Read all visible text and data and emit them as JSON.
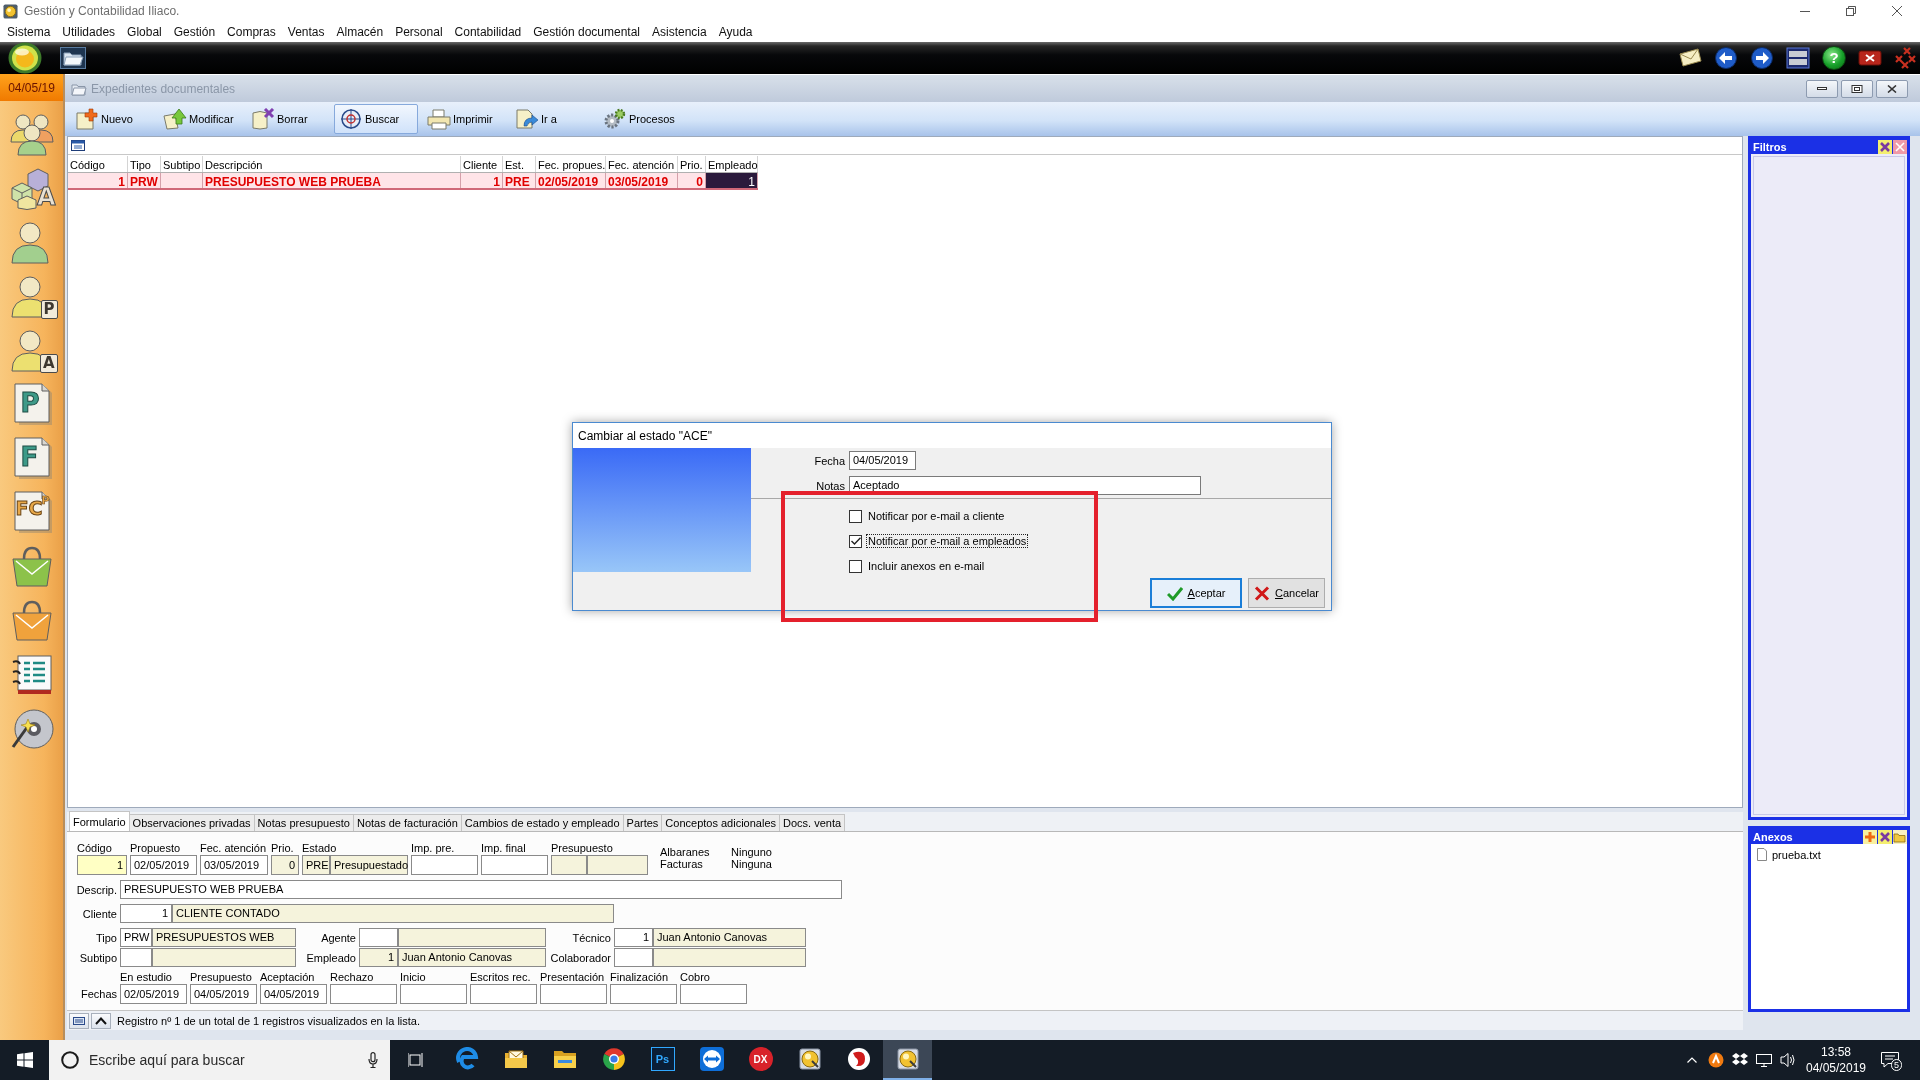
{
  "window": {
    "title": "Gestión y Contabilidad Iliaco."
  },
  "menu": [
    "Sistema",
    "Utilidades",
    "Global",
    "Gestión",
    "Compras",
    "Ventas",
    "Almacén",
    "Personal",
    "Contabilidad",
    "Gestión documental",
    "Asistencia",
    "Ayuda"
  ],
  "main_toolbar": {
    "help_button": "?"
  },
  "sidebar": {
    "date": "04/05/19",
    "items": [
      {
        "kind": "people"
      },
      {
        "kind": "boxes",
        "letter": "A"
      },
      {
        "kind": "person"
      },
      {
        "kind": "person",
        "letter": "P"
      },
      {
        "kind": "person",
        "letter": "A"
      },
      {
        "kind": "document",
        "letter": "P"
      },
      {
        "kind": "document",
        "letter": "F"
      },
      {
        "kind": "document",
        "letter": "FC",
        "corner": "P"
      },
      {
        "kind": "bag",
        "color": "#8cc24a"
      },
      {
        "kind": "bag",
        "color": "#f0a23c"
      },
      {
        "kind": "notebook"
      },
      {
        "kind": "disc"
      }
    ]
  },
  "document_window": {
    "title": "Expedientes documentales",
    "toolbar": [
      {
        "kind": "new",
        "label": "Nuevo",
        "selected": false
      },
      {
        "kind": "edit",
        "label": "Modificar",
        "selected": false
      },
      {
        "kind": "delete",
        "label": "Borrar",
        "selected": false
      },
      {
        "kind": "search",
        "label": "Buscar",
        "selected": true
      },
      {
        "kind": "print",
        "label": "Imprimir",
        "selected": false
      },
      {
        "kind": "goto",
        "label": "Ir a",
        "selected": false
      },
      {
        "kind": "process",
        "label": "Procesos",
        "selected": false
      }
    ]
  },
  "table": {
    "columns": [
      "Código",
      "Tipo",
      "Subtipo",
      "Descripción",
      "Cliente",
      "Est.",
      "Fec. propues.",
      "Fec. atención",
      "Prio.",
      "Empleado"
    ],
    "rows": [
      {
        "selected": true,
        "color": "#2b1a3c",
        "cells": [
          "1",
          "PRW",
          null,
          "PRESUPUESTO WEB PRUEBA",
          "1",
          "PRE",
          "02/05/2019",
          "03/05/2019",
          "0",
          "1"
        ]
      }
    ]
  },
  "filters_panel": {
    "title": "Filtros"
  },
  "attachments_panel": {
    "title": "Anexos",
    "files": [
      "prueba.txt"
    ]
  },
  "detail_tabs": [
    {
      "label": "Formulario",
      "selected": true
    },
    {
      "label": "Observaciones privadas",
      "selected": false
    },
    {
      "label": "Notas presupuesto",
      "selected": false
    },
    {
      "label": "Notas de facturación",
      "selected": false
    },
    {
      "label": "Cambios de estado y empleado",
      "selected": false
    },
    {
      "label": "Partes",
      "selected": false
    },
    {
      "label": "Conceptos adicionales",
      "selected": false
    },
    {
      "label": "Docs. venta",
      "selected": false
    }
  ],
  "form": {
    "top_fields": [
      {
        "label": "Código",
        "parts": [
          {
            "kind": "key",
            "value": "1"
          }
        ]
      },
      {
        "label": "Propuesto",
        "parts": [
          {
            "kind": "edit",
            "value": "02/05/2019"
          }
        ]
      },
      {
        "label": "Fec. atención",
        "parts": [
          {
            "kind": "edit",
            "value": "03/05/2019"
          }
        ]
      },
      {
        "label": "Prio.",
        "parts": [
          {
            "kind": "readonly",
            "value": "0"
          }
        ]
      },
      {
        "label": "Estado",
        "parts": [
          {
            "kind": "readonly",
            "value": "PRE"
          },
          {
            "kind": "readonly",
            "value": "Presupuestado"
          }
        ]
      },
      {
        "label": "Imp. pre.",
        "parts": [
          {
            "kind": "edit"
          }
        ]
      },
      {
        "label": "Imp. final",
        "parts": [
          {
            "kind": "edit"
          }
        ]
      },
      {
        "label": "Presupuesto",
        "parts": [
          {
            "kind": "readonly"
          },
          {
            "kind": "readonly"
          }
        ]
      }
    ],
    "related": [
      {
        "label": "Albaranes",
        "value": "Ninguno"
      },
      {
        "label": "Facturas",
        "value": "Ninguna"
      }
    ],
    "lines": [
      [
        {
          "label": "Descrip.",
          "parts": [
            {
              "kind": "edit",
              "value": "PRESUPUESTO WEB PRUEBA"
            }
          ]
        }
      ],
      [
        {
          "label": "Cliente",
          "parts": [
            {
              "kind": "edit",
              "value": "1"
            },
            {
              "kind": "readonly",
              "value": "CLIENTE CONTADO"
            }
          ]
        }
      ],
      [
        {
          "label": "Tipo",
          "parts": [
            {
              "kind": "edit",
              "value": "PRW"
            },
            {
              "kind": "readonly",
              "value": "PRESUPUESTOS WEB"
            }
          ]
        },
        {
          "label": "Agente",
          "parts": [
            {
              "kind": "edit"
            },
            {
              "kind": "readonly"
            }
          ]
        },
        {
          "label": "Técnico",
          "parts": [
            {
              "kind": "edit",
              "value": "1"
            },
            {
              "kind": "readonly",
              "value": "Juan Antonio Canovas"
            }
          ]
        }
      ],
      [
        {
          "label": "Subtipo",
          "parts": [
            {
              "kind": "edit"
            },
            {
              "kind": "readonly"
            }
          ]
        },
        {
          "label": "Empleado",
          "parts": [
            {
              "kind": "readonly",
              "value": "1"
            },
            {
              "kind": "readonly",
              "value": "Juan Antonio Canovas"
            }
          ]
        },
        {
          "label": "Colaborador",
          "parts": [
            {
              "kind": "edit"
            },
            {
              "kind": "readonly"
            }
          ]
        }
      ]
    ],
    "dates": {
      "label": "Fechas",
      "fields": [
        {
          "label": "En estudio",
          "value": "02/05/2019"
        },
        {
          "label": "Presupuesto",
          "value": "04/05/2019"
        },
        {
          "label": "Aceptación",
          "value": "04/05/2019"
        },
        {
          "label": "Rechazo"
        },
        {
          "label": "Inicio"
        },
        {
          "label": "Escritos rec."
        },
        {
          "label": "Presentación"
        },
        {
          "label": "Finalización"
        },
        {
          "label": "Cobro"
        }
      ]
    }
  },
  "status_bar": {
    "text": "Registro nº 1 de un total de 1 registros visualizados en la lista."
  },
  "dialog": {
    "title": "Cambiar al estado \"ACE\"",
    "fields": [
      {
        "label": "Fecha",
        "value": "04/05/2019"
      },
      {
        "label": "Notas",
        "value": "Aceptado"
      }
    ],
    "options": [
      {
        "label": "Notificar por e-mail a cliente",
        "checked": false,
        "focused": false
      },
      {
        "label": "Notificar por e-mail a empleados",
        "checked": true,
        "focused": true
      },
      {
        "label": "Incluir anexos en e-mail",
        "checked": false,
        "focused": false
      }
    ],
    "buttons": [
      {
        "kind": "accept",
        "label": "Aceptar",
        "default": true
      },
      {
        "kind": "cancel",
        "label": "Cancelar",
        "default": false
      }
    ]
  },
  "taskbar": {
    "search": {
      "placeholder": "Escribe aquí para buscar"
    },
    "apps": [
      {
        "kind": "edge",
        "active": false
      },
      {
        "kind": "mail",
        "active": false
      },
      {
        "kind": "explorer",
        "active": false
      },
      {
        "kind": "chrome",
        "active": false
      },
      {
        "kind": "photoshop",
        "label": "Ps",
        "active": false
      },
      {
        "kind": "teamviewer",
        "active": false
      },
      {
        "kind": "dx",
        "label": "DX",
        "active": false
      },
      {
        "kind": "app",
        "active": false
      },
      {
        "kind": "redapp",
        "active": false
      },
      {
        "kind": "app",
        "active": true
      }
    ],
    "clock": {
      "time": "13:58",
      "date": "04/05/2019"
    },
    "notifications": "5"
  }
}
